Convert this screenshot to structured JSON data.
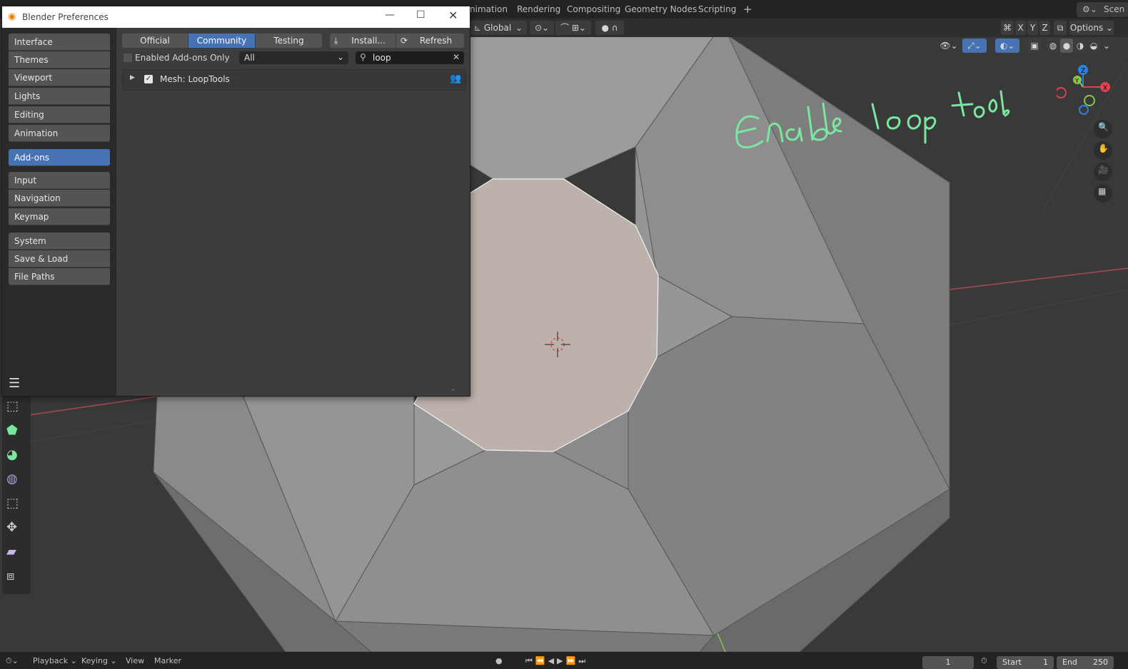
{
  "topbar": {
    "workspace_tabs": [
      "nimation",
      "Rendering",
      "Compositing",
      "Geometry Nodes",
      "Scripting"
    ],
    "add_tab": "+",
    "scene_label": "Scen"
  },
  "viewport_header": {
    "orientation": "Global",
    "axes": [
      "X",
      "Y",
      "Z"
    ],
    "options_label": "Options"
  },
  "prefs": {
    "title": "Blender Preferences",
    "sidebar": {
      "group1": [
        "Interface",
        "Themes",
        "Viewport",
        "Lights",
        "Editing",
        "Animation"
      ],
      "active": "Add-ons",
      "group2": [
        "Input",
        "Navigation",
        "Keymap"
      ],
      "group3": [
        "System",
        "Save & Load",
        "File Paths"
      ]
    },
    "tabs": {
      "official": "Official",
      "community": "Community",
      "testing": "Testing",
      "install": "Install...",
      "refresh": "Refresh"
    },
    "filter": {
      "enabled_only_label": "Enabled Add-ons Only",
      "category": "All",
      "search_value": "loop"
    },
    "addon": {
      "name": "Mesh: LoopTools",
      "enabled": true
    }
  },
  "annotation": {
    "text": "Enable loop tools",
    "color": "#7be6a0"
  },
  "timeline": {
    "playback": "Playback",
    "keying": "Keying",
    "view": "View",
    "marker": "Marker",
    "current_frame": "1",
    "start_label": "Start",
    "start_value": "1",
    "end_label": "End",
    "end_value": "250"
  },
  "colors": {
    "accent": "#4772b3",
    "annotation": "#7be6a0",
    "axis_x": "#e0434f",
    "axis_y": "#8bc34a",
    "axis_z": "#2f7fe0"
  }
}
